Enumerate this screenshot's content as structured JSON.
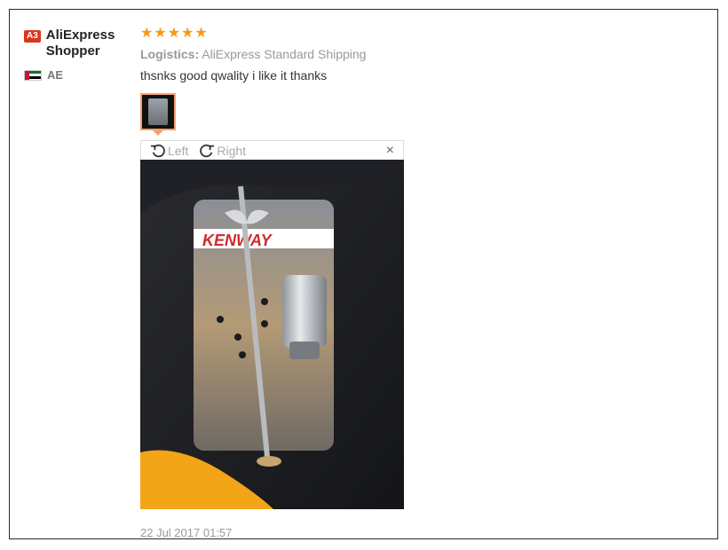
{
  "user": {
    "level_badge": "A3",
    "name": "AliExpress Shopper",
    "country": "AE"
  },
  "review": {
    "rating": 5,
    "logistics_label": "Logistics:",
    "logistics_value": "AliExpress Standard Shipping",
    "comment": "thsnks good qwality i like it thanks",
    "date": "22 Jul 2017 01:57"
  },
  "viewer": {
    "rotate_left_label": "Left",
    "rotate_right_label": "Right",
    "close_glyph": "×"
  },
  "photo": {
    "package_brand": "KENWAY"
  },
  "colors": {
    "star": "#f39c12",
    "badge": "#d9381e",
    "thumb_border": "#f5a26b"
  }
}
